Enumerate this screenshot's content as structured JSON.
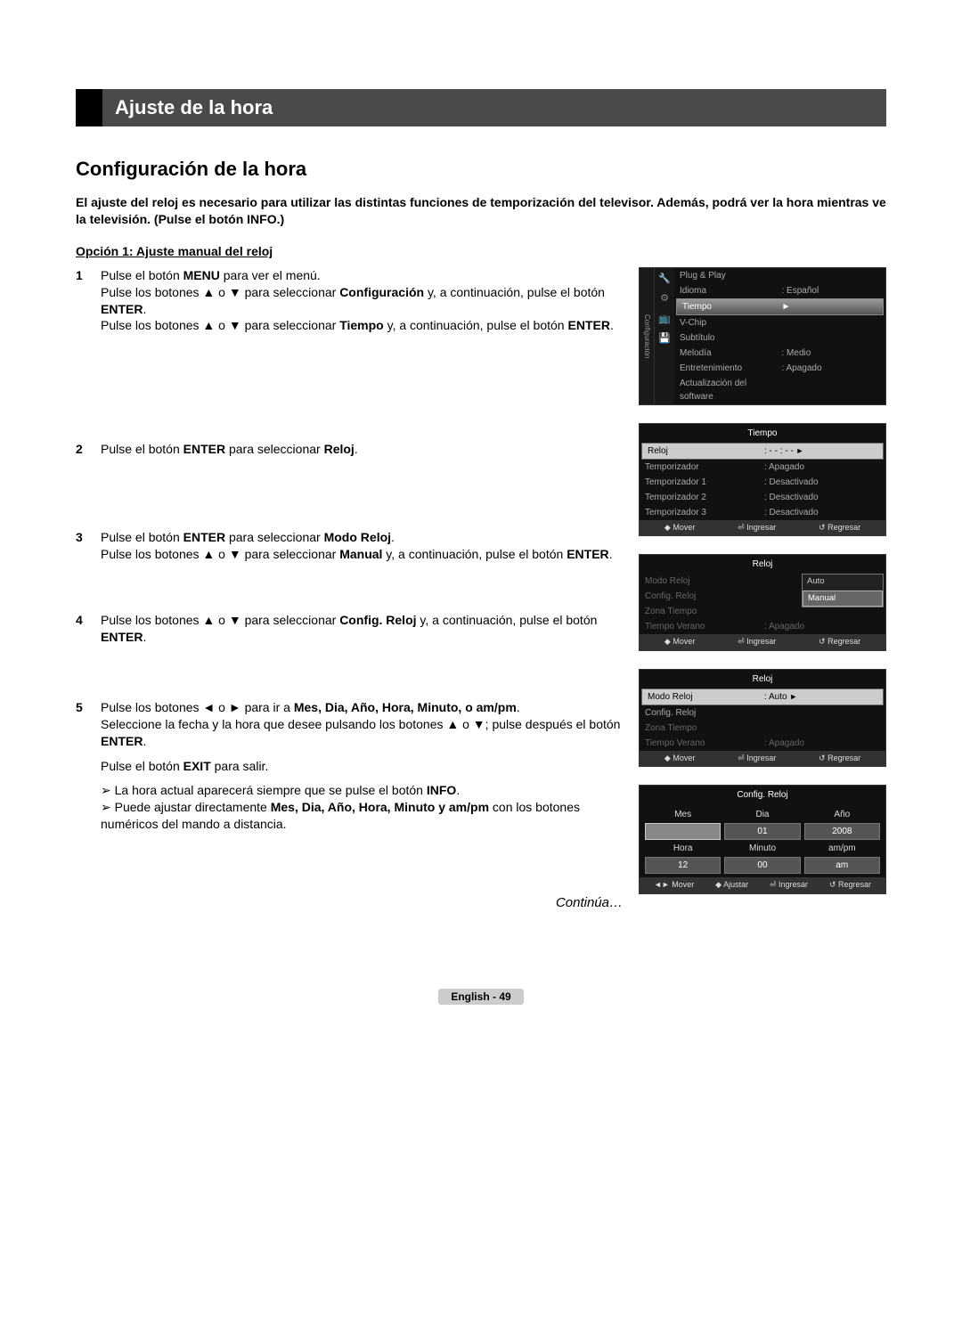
{
  "titleBar": "Ajuste de la hora",
  "heading": "Configuración de la hora",
  "intro": "El ajuste del reloj es necesario para utilizar las distintas funciones de temporización del televisor. Además, podrá ver la hora mientras ve la televisión. (Pulse el botón INFO.)",
  "option1Title": "Opción 1: Ajuste manual del reloj",
  "steps": {
    "1": {
      "lines": [
        {
          "pre": "Pulse el botón ",
          "b": "MENU",
          "post": " para ver el menú."
        },
        {
          "pre": "Pulse los botones ▲ o ▼ para seleccionar ",
          "b": "Configuración",
          "post": " y, a continuación, pulse el botón "
        },
        {
          "pre": "",
          "b": "ENTER",
          "post": "."
        },
        {
          "pre": "Pulse los botones ▲ o ▼ para seleccionar ",
          "b": "Tiempo",
          "post": " y, a continuación, pulse el botón "
        },
        {
          "pre": "",
          "b": "ENTER",
          "post": "."
        }
      ]
    },
    "2": {
      "text": "Pulse el botón ",
      "b": "ENTER",
      "mid": " para seleccionar ",
      "b2": "Reloj",
      "post": "."
    },
    "3": {
      "l1a": "Pulse el botón ",
      "l1b": "ENTER",
      "l1c": " para seleccionar ",
      "l1d": "Modo Reloj",
      "l1e": ".",
      "l2a": "Pulse los botones ▲ o ▼ para seleccionar ",
      "l2b": "Manual",
      "l2c": " y, a continuación, pulse el botón ",
      "l2d": "ENTER",
      "l2e": "."
    },
    "4": {
      "a": "Pulse los botones ▲ o ▼ para seleccionar ",
      "b": "Config. Reloj",
      "c": " y, a continuación, pulse el botón ",
      "d": "ENTER",
      "e": "."
    },
    "5": {
      "l1a": "Pulse los botones ◄ o ► para ir a ",
      "items": "Mes, Dia, Año, Hora, Minuto, o am/pm",
      "l1b": ".",
      "l2": "Seleccione la fecha y la hora que desee pulsando los botones ▲ o ▼; pulse después el botón ",
      "l2b": "ENTER",
      "l2c": ".",
      "l3a": "Pulse el botón ",
      "l3b": "EXIT",
      "l3c": " para salir.",
      "n1": "➢  La hora actual aparecerá siempre que se pulse el botón ",
      "n1b": "INFO",
      "n1c": ".",
      "n2": "➢  Puede ajustar directamente ",
      "n2items": "Mes, Dia, Año, Hora, Minuto y am/pm",
      "n2b": " con los botones numéricos del mando a distancia."
    }
  },
  "continue": "Continúa…",
  "footer": {
    "lang": "English - ",
    "page": "49"
  },
  "osd1": {
    "sidebar": "Configuración",
    "items": [
      {
        "k": "Plug & Play",
        "v": ""
      },
      {
        "k": "Idioma",
        "v": ": Español"
      },
      {
        "k": "Tiempo",
        "v": "►",
        "hl": true
      },
      {
        "k": "V-Chip",
        "v": ""
      },
      {
        "k": "Subtítulo",
        "v": ""
      },
      {
        "k": "Melodía",
        "v": ": Medio"
      },
      {
        "k": "Entretenimiento",
        "v": ": Apagado"
      },
      {
        "k": "Actualización del software",
        "v": ""
      }
    ]
  },
  "osd2": {
    "title": "Tiempo",
    "items": [
      {
        "k": "Reloj",
        "v": ": - - : - -",
        "sel": true,
        "caret": "►"
      },
      {
        "k": "Temporizador",
        "v": ": Apagado"
      },
      {
        "k": "Temporizador 1",
        "v": ": Desactivado"
      },
      {
        "k": "Temporizador 2",
        "v": ": Desactivado"
      },
      {
        "k": "Temporizador 3",
        "v": ": Desactivado"
      }
    ],
    "footer": [
      "◆ Mover",
      "⏎ Ingresar",
      "↺ Regresar"
    ]
  },
  "osd3": {
    "title": "Reloj",
    "items": [
      {
        "k": "Modo Reloj",
        "v": "",
        "dim": true
      },
      {
        "k": "Config. Reloj",
        "v": "",
        "dim": true
      },
      {
        "k": "Zona Tiempo",
        "v": "",
        "dim": true
      },
      {
        "k": "Tiempo Verano",
        "v": ": Apagado",
        "dim": true
      }
    ],
    "popup": [
      "Auto",
      "Manual"
    ],
    "popupSel": "Manual",
    "footer": [
      "◆ Mover",
      "⏎ Ingresar",
      "↺ Regresar"
    ]
  },
  "osd4": {
    "title": "Reloj",
    "items": [
      {
        "k": "Modo Reloj",
        "v": ": Auto",
        "sel": true,
        "caret": "►"
      },
      {
        "k": "Config. Reloj",
        "v": ""
      },
      {
        "k": "Zona Tiempo",
        "v": "",
        "dim": true
      },
      {
        "k": "Tiempo Verano",
        "v": ": Apagado",
        "dim": true
      }
    ],
    "footer": [
      "◆ Mover",
      "⏎ Ingresar",
      "↺ Regresar"
    ]
  },
  "osd5": {
    "title": "Config. Reloj",
    "headers": [
      "Mes",
      "Dia",
      "Año"
    ],
    "row1": [
      " ",
      "01",
      "2008"
    ],
    "row1active": 0,
    "headers2": [
      "Hora",
      "Minuto",
      "am/pm"
    ],
    "row2": [
      "12",
      "00",
      "am"
    ],
    "footer": [
      "◄► Mover",
      "◆ Ajustar",
      "⏎ Ingresar",
      "↺ Regresar"
    ]
  }
}
